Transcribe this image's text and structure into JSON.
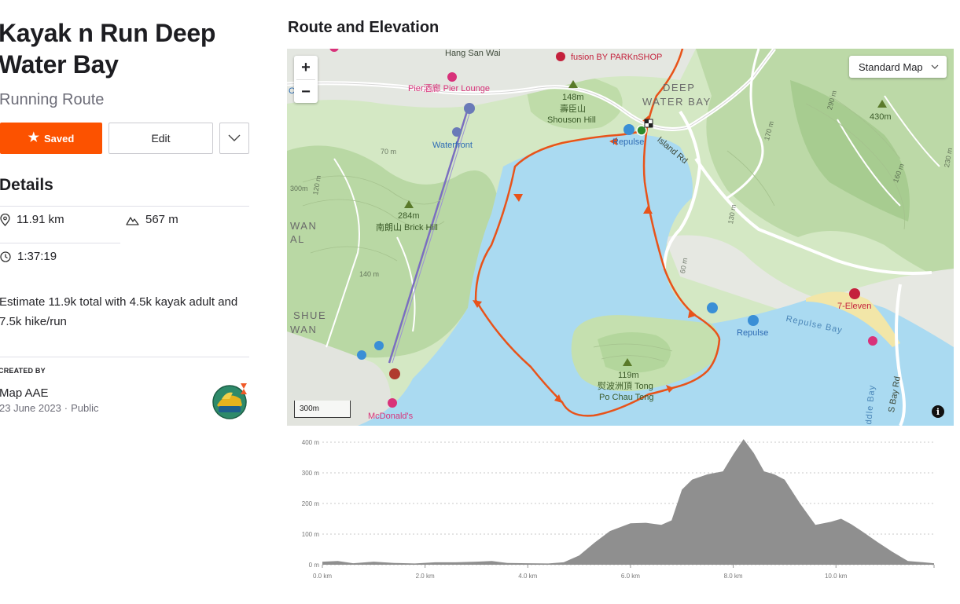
{
  "route": {
    "title": "Kayak n Run Deep Water Bay",
    "type": "Running Route",
    "saved_label": "Saved",
    "edit_label": "Edit"
  },
  "details": {
    "heading": "Details",
    "distance": "11.91 km",
    "elevation_gain": "567 m",
    "moving_time": "1:37:19",
    "description": "Estimate 11.9k total with 4.5k kayak adult and 7.5k hike/run"
  },
  "creator": {
    "label": "CREATED BY",
    "name": "Map AAE",
    "date": "23 June 2023",
    "visibility": "Public"
  },
  "map": {
    "section_title": "Route and Elevation",
    "style_select": "Standard Map",
    "scale": "300m",
    "info": "i",
    "labels": {
      "hang_san_wai": "Hang San Wai",
      "fusion": "fusion BY PARKnSHOP",
      "pier_lounge": "Pier酒廊 Pier Lounge",
      "clang": "Clang",
      "waterfront": "Waterfront",
      "shouson_elev": "148m",
      "shouson_cn": "壽臣山",
      "shouson_en": "Shouson Hill",
      "deep_1": "DEEP",
      "deep_2": "WATER BAY",
      "repulse_1": "Repulse",
      "island_rd": "Island Rd",
      "peak_430": "430m",
      "brick_elev": "284m",
      "brick_name": "南朗山 Brick Hill",
      "wan_1": "WAN",
      "wan_2": "AL",
      "shue_1": "SHUE",
      "shue_2": "WAN",
      "seven_eleven": "7-Eleven",
      "repulse_2": "Repulse",
      "repulse_bay": "Repulse Bay",
      "tong_elev": "119m",
      "tong_name_1": "熨波洲頂 Tong",
      "tong_name_2": "Po Chau Teng",
      "mcdonalds": "McDonald's",
      "s_bay_rd": "S Bay Rd",
      "ddle_bay": "ddle Bay",
      "c70": "70 m",
      "c120": "120 m",
      "c140": "140 m",
      "c300": "300m",
      "c290": "290 m",
      "c170": "170 m",
      "c130": "130 m",
      "c160": "160 m",
      "c60": "60 m",
      "c230": "230 m"
    }
  },
  "elevation": {
    "y_ticks": [
      "400 m",
      "300 m",
      "200 m",
      "100 m",
      "0 m"
    ],
    "x_ticks": [
      "0.0 km",
      "2.0 km",
      "4.0 km",
      "6.0 km",
      "8.0 km",
      "10.0 km"
    ],
    "fill_color": "#8f8f8f"
  },
  "chart_data": {
    "type": "area",
    "title": "",
    "xlabel": "",
    "ylabel": "",
    "xlim": [
      0,
      11.91
    ],
    "ylim": [
      0,
      400
    ],
    "grid": true,
    "x": [
      0,
      0.3,
      0.6,
      1.0,
      1.4,
      1.8,
      2.2,
      2.6,
      3.0,
      3.3,
      3.6,
      4.0,
      4.4,
      4.7,
      5.0,
      5.3,
      5.6,
      6.0,
      6.3,
      6.6,
      6.8,
      7.0,
      7.2,
      7.5,
      7.8,
      8.0,
      8.2,
      8.4,
      8.6,
      8.8,
      9.0,
      9.3,
      9.6,
      9.9,
      10.1,
      10.3,
      10.5,
      10.8,
      11.1,
      11.4,
      11.7,
      11.91
    ],
    "series": [
      {
        "values": [
          10,
          12,
          5,
          10,
          6,
          4,
          8,
          8,
          10,
          12,
          6,
          5,
          4,
          8,
          30,
          72,
          110,
          135,
          137,
          130,
          145,
          245,
          278,
          295,
          305,
          360,
          410,
          365,
          305,
          295,
          278,
          200,
          130,
          140,
          150,
          132,
          110,
          75,
          42,
          12,
          8,
          5
        ]
      }
    ]
  }
}
